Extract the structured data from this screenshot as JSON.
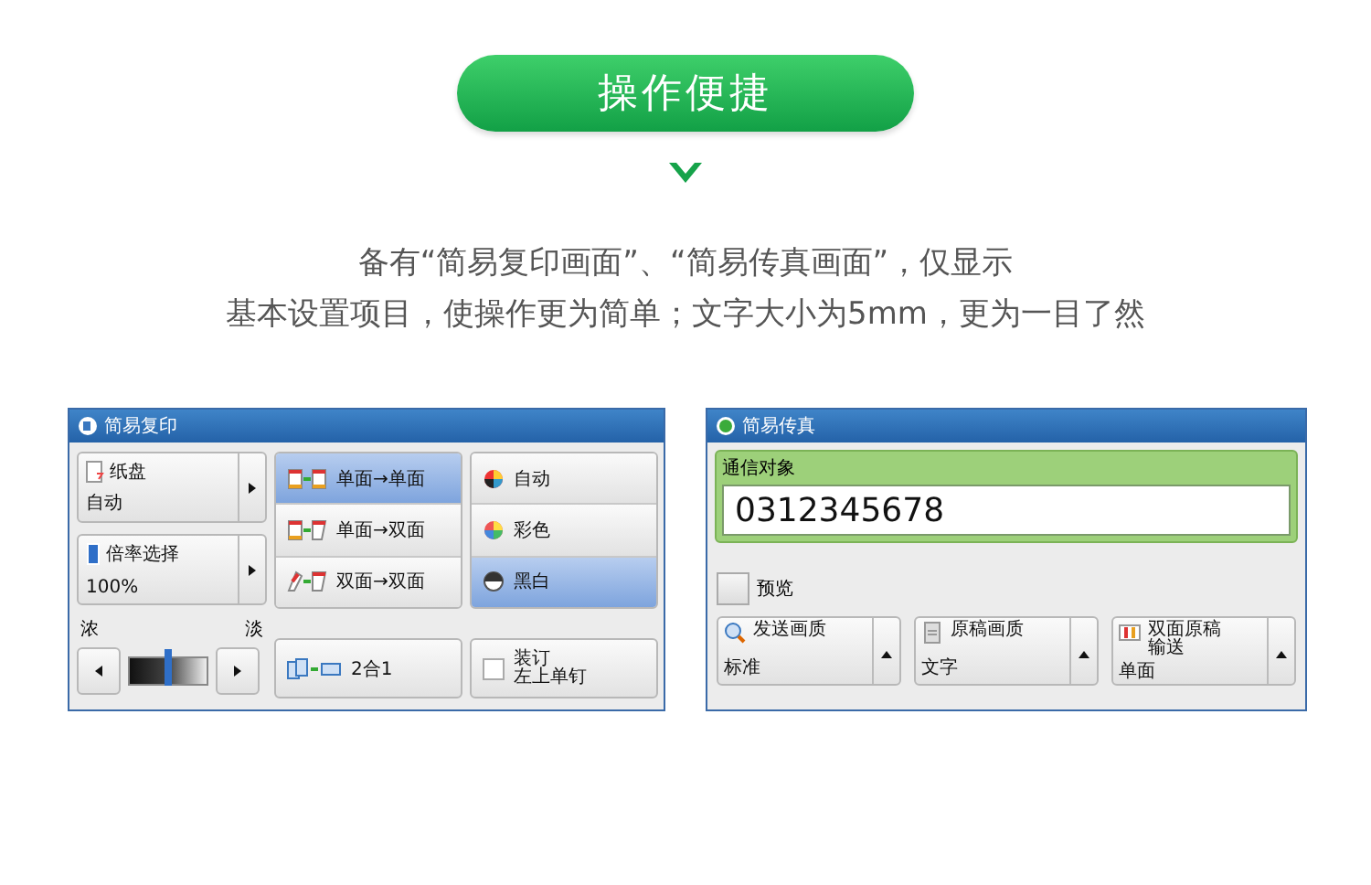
{
  "banner": {
    "title": "操作便捷"
  },
  "description": [
    "备有“简易复印画面”、“简易传真画面”，仅显示",
    "基本设置项目，使操作更为简单；文字大小为5mm，更为一目了然"
  ],
  "copy_panel": {
    "title": "简易复印",
    "paper": {
      "label": "纸盘",
      "value": "自动"
    },
    "zoom": {
      "label": "倍率选择",
      "value": "100%"
    },
    "density": {
      "dark_label": "浓",
      "light_label": "淡",
      "level": 0.5
    },
    "sides_options": [
      {
        "label": "单面→单面",
        "kind": "simplex",
        "selected": true
      },
      {
        "label": "单面→双面",
        "kind": "to-duplex",
        "selected": false
      },
      {
        "label": "双面→双面",
        "kind": "duplex",
        "selected": false
      }
    ],
    "color_options": [
      {
        "label": "自动",
        "kind": "auto",
        "selected": false
      },
      {
        "label": "彩色",
        "kind": "color",
        "selected": false
      },
      {
        "label": "黑白",
        "kind": "mono",
        "selected": true
      }
    ],
    "nup": {
      "label": "2合1"
    },
    "staple": {
      "label": "装订",
      "value": "左上单钉"
    }
  },
  "fax_panel": {
    "title": "简易传真",
    "recipient": {
      "label": "通信对象",
      "value": "0312345678"
    },
    "preview": {
      "label": "预览",
      "checked": false
    },
    "settings": [
      {
        "label": "发送画质",
        "kind": "resolution",
        "value": "标准"
      },
      {
        "label": "原稿画质",
        "kind": "original",
        "value": "文字"
      },
      {
        "label": "双面原稿输送",
        "kind": "duplex",
        "value": "单面"
      }
    ]
  }
}
